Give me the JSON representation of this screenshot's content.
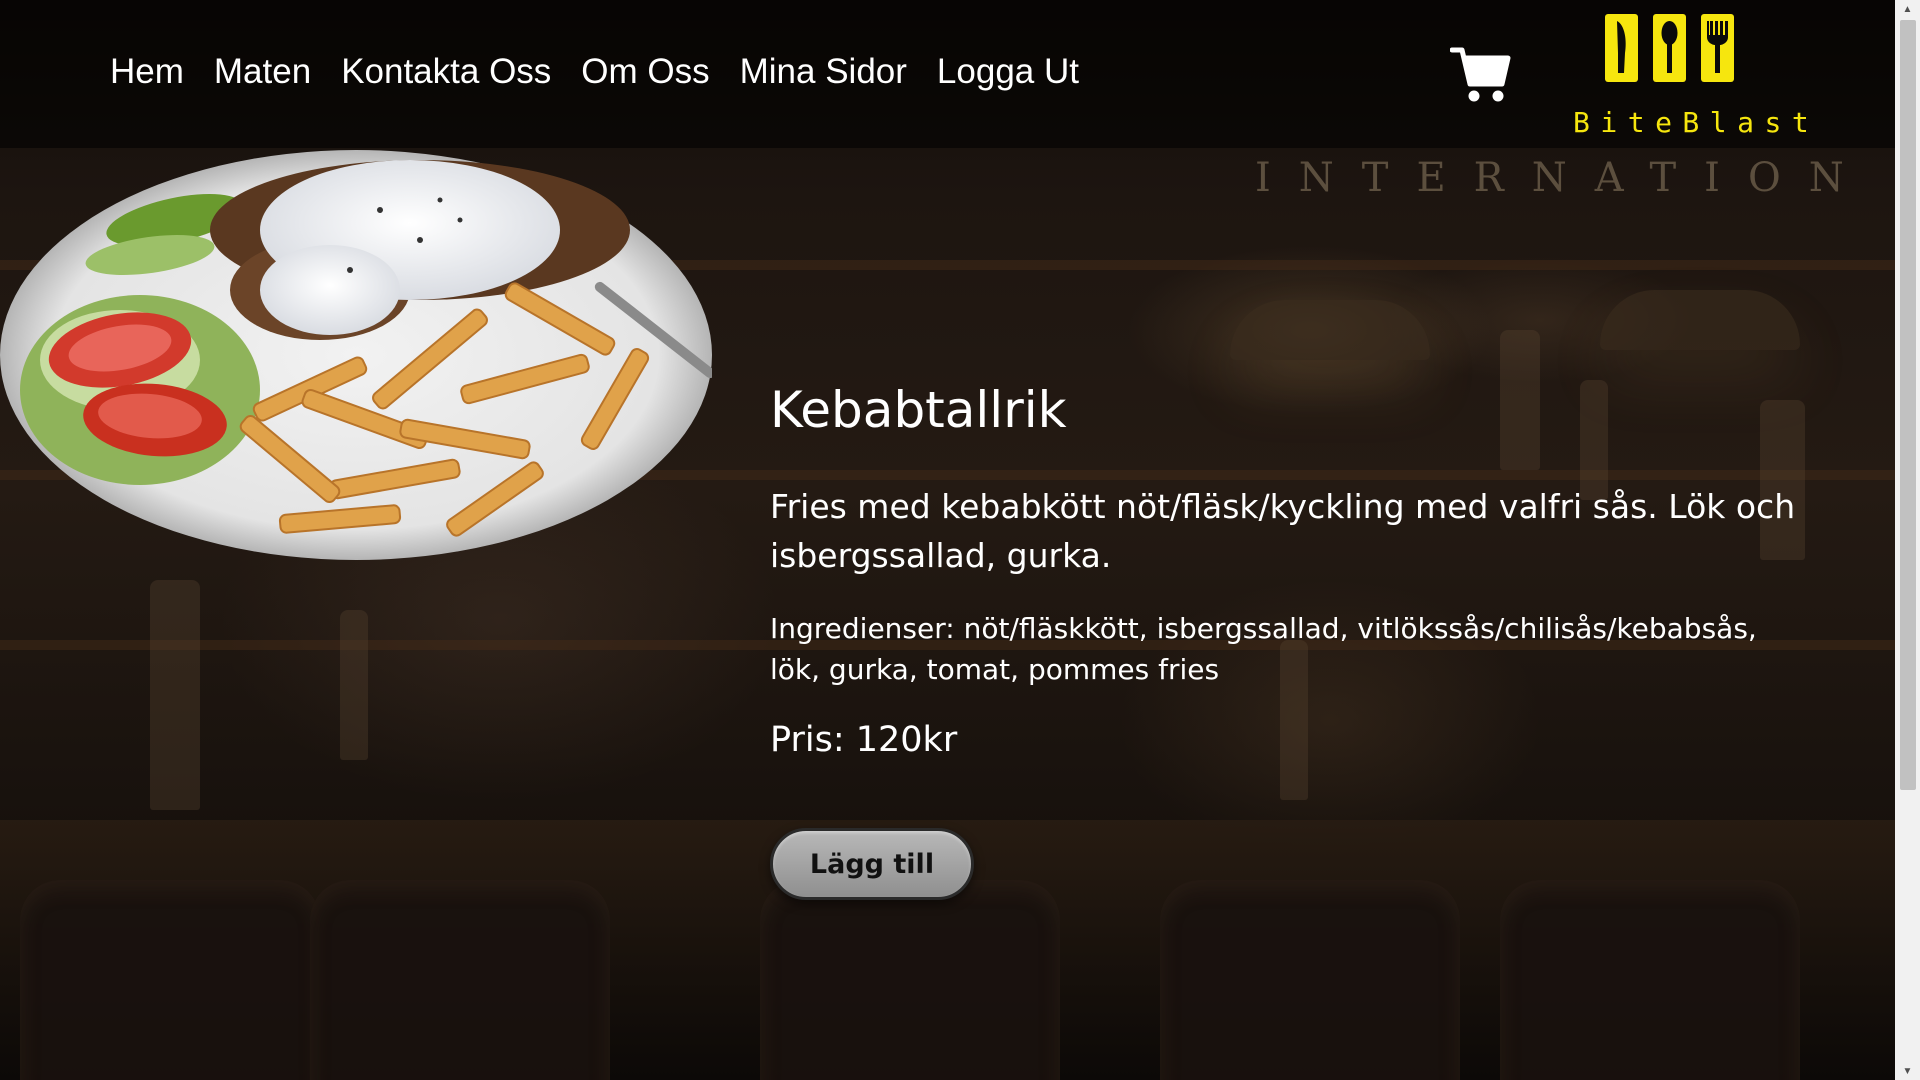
{
  "nav": {
    "items": [
      {
        "label": "Hem"
      },
      {
        "label": "Maten"
      },
      {
        "label": "Kontakta Oss"
      },
      {
        "label": "Om Oss"
      },
      {
        "label": "Mina Sidor"
      },
      {
        "label": "Logga Ut"
      }
    ]
  },
  "header": {
    "cart_icon": "shopping-cart-icon",
    "logo_text": "BiteBlast",
    "logo_icons": [
      "knife-icon",
      "spoon-icon",
      "fork-icon"
    ],
    "logo_color": "#f6e60e"
  },
  "product": {
    "image_icon": "kebab-plate-image",
    "title": "Kebabtallrik",
    "description": "Fries med kebabkött nöt/fläsk/kyckling med valfri sås. Lök och isbergssallad, gurka.",
    "ingredients": "Ingredienser: nöt/fläskkött, isbergssallad, vitlökssås/chilisås/kebabsås, lök, gurka, tomat, pommes fries",
    "price": "Pris: 120kr",
    "add_button": "Lägg till"
  },
  "background": {
    "sign_text": "INTERNATION"
  },
  "scrollbar": {
    "up_icon": "scroll-up-arrow-icon",
    "down_icon": "scroll-down-arrow-icon"
  }
}
